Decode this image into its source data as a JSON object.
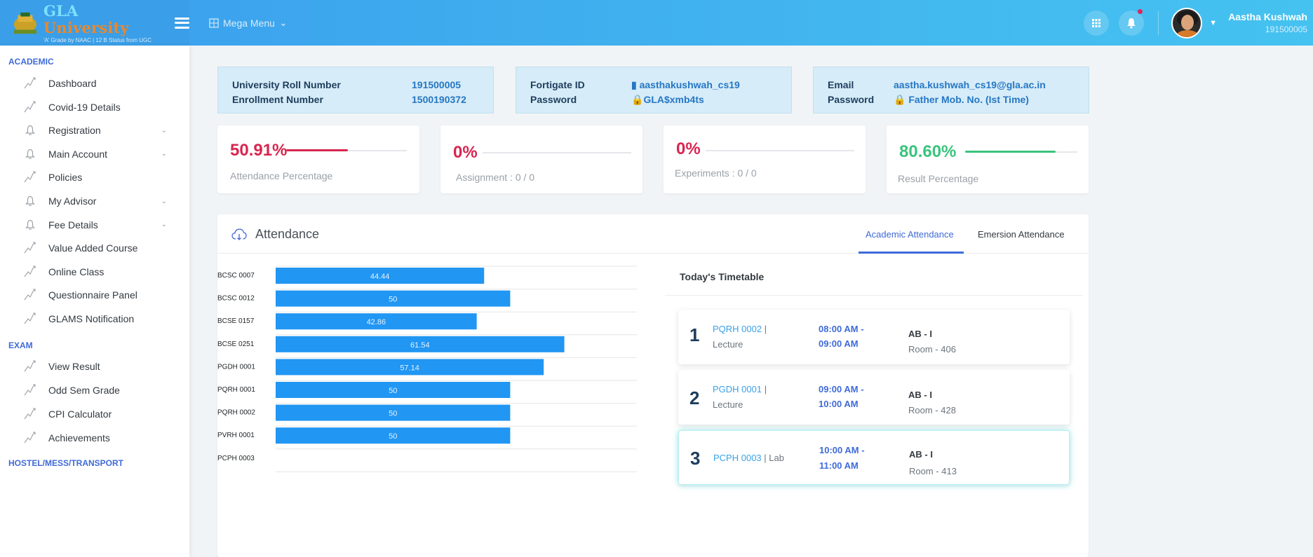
{
  "brand": {
    "title_a": "GLA",
    "title_b": "University",
    "subtitle": "'A' Grade by NAAC | 12 B Status from UGC"
  },
  "header": {
    "mega_menu": "Mega Menu",
    "user_name": "Aastha Kushwah",
    "user_id": "191500005"
  },
  "sidebar": {
    "sections": [
      "ACADEMIC",
      "EXAM",
      "HOSTEL/MESS/TRANSPORT"
    ],
    "academic_items": [
      {
        "label": "Dashboard",
        "icon": "chart-line-icon"
      },
      {
        "label": "Covid-19 Details",
        "icon": "chart-line-icon"
      },
      {
        "label": "Registration",
        "icon": "bell-icon",
        "expandable": true
      },
      {
        "label": "Main Account",
        "icon": "bell-icon",
        "expandable": true
      },
      {
        "label": "Policies",
        "icon": "chart-line-icon"
      },
      {
        "label": "My Advisor",
        "icon": "bell-icon",
        "expandable": true
      },
      {
        "label": "Fee Details",
        "icon": "bell-icon",
        "expandable": true
      },
      {
        "label": "Value Added Course",
        "icon": "chart-line-icon"
      },
      {
        "label": "Online Class",
        "icon": "chart-line-icon"
      },
      {
        "label": "Questionnaire Panel",
        "icon": "chart-line-icon"
      },
      {
        "label": "GLAMS Notification",
        "icon": "chart-line-icon"
      }
    ],
    "exam_items": [
      {
        "label": "View Result",
        "icon": "chart-line-icon"
      },
      {
        "label": "Odd Sem Grade",
        "icon": "chart-line-icon"
      },
      {
        "label": "CPI Calculator",
        "icon": "chart-line-icon"
      },
      {
        "label": "Achievements",
        "icon": "chart-line-icon"
      }
    ]
  },
  "info_cards": {
    "roll_label": "University Roll Number",
    "roll_value": "191500005",
    "enroll_label": "Enrollment Number",
    "enroll_value": "1500190372",
    "fortigate_label": "Fortigate ID",
    "fortigate_value": "aasthakushwah_cs19",
    "fortigate_pw_label": "Password",
    "fortigate_pw_value": "GLA$xmb4ts",
    "email_label": "Email",
    "email_value": "aastha.kushwah_cs19@gla.ac.in",
    "email_pw_label": "Password",
    "email_pw_value": "Father Mob. No. (Ist Time)"
  },
  "stats": [
    {
      "value": "50.91%",
      "caption": "Attendance Percentage",
      "fraction": 0.5091,
      "color": "#d92550"
    },
    {
      "value": "0%",
      "caption": "Assignment : 0 / 0",
      "fraction": 0,
      "color": "#d92550"
    },
    {
      "value": "0%",
      "caption": "Experiments : 0 / 0",
      "fraction": 0,
      "color": "#d92550"
    },
    {
      "value": "80.60%",
      "caption": "Result Percentage",
      "fraction": 0.806,
      "color": "#3ac47d"
    }
  ],
  "attendance": {
    "title": "Attendance",
    "tab_academic": "Academic Attendance",
    "tab_emersion": "Emersion Attendance"
  },
  "chart_data": {
    "type": "bar",
    "orientation": "horizontal",
    "categories": [
      "BCSC 0007",
      "BCSC 0012",
      "BCSE 0157",
      "BCSE 0251",
      "PGDH 0001",
      "PQRH 0001",
      "PQRH 0002",
      "PVRH 0001",
      "PCPH 0003"
    ],
    "values": [
      44.44,
      50,
      42.86,
      61.54,
      57.14,
      50,
      50,
      50,
      null
    ],
    "value_labels": [
      "44.44",
      "50",
      "42.86",
      "61.54",
      "57.14",
      "50",
      "50",
      "50",
      ""
    ],
    "xlim": [
      0,
      77
    ],
    "bar_color": "#2196f3",
    "grid": true
  },
  "timetable": {
    "title": "Today's Timetable",
    "slots": [
      {
        "num": "1",
        "code": "PQRH 0002",
        "kind": "Lecture",
        "time_start": "08:00 AM -",
        "time_end": "09:00 AM",
        "block": "AB - I",
        "room": "Room - 406"
      },
      {
        "num": "2",
        "code": "PGDH 0001",
        "kind": "Lecture",
        "time_start": "09:00 AM -",
        "time_end": "10:00 AM",
        "block": "AB - I",
        "room": "Room - 428"
      },
      {
        "num": "3",
        "code": "PCPH 0003",
        "kind": "Lab",
        "time_start": "10:00 AM -",
        "time_end": "11:00 AM",
        "block": "AB - I",
        "room": "Room - 413"
      }
    ]
  }
}
